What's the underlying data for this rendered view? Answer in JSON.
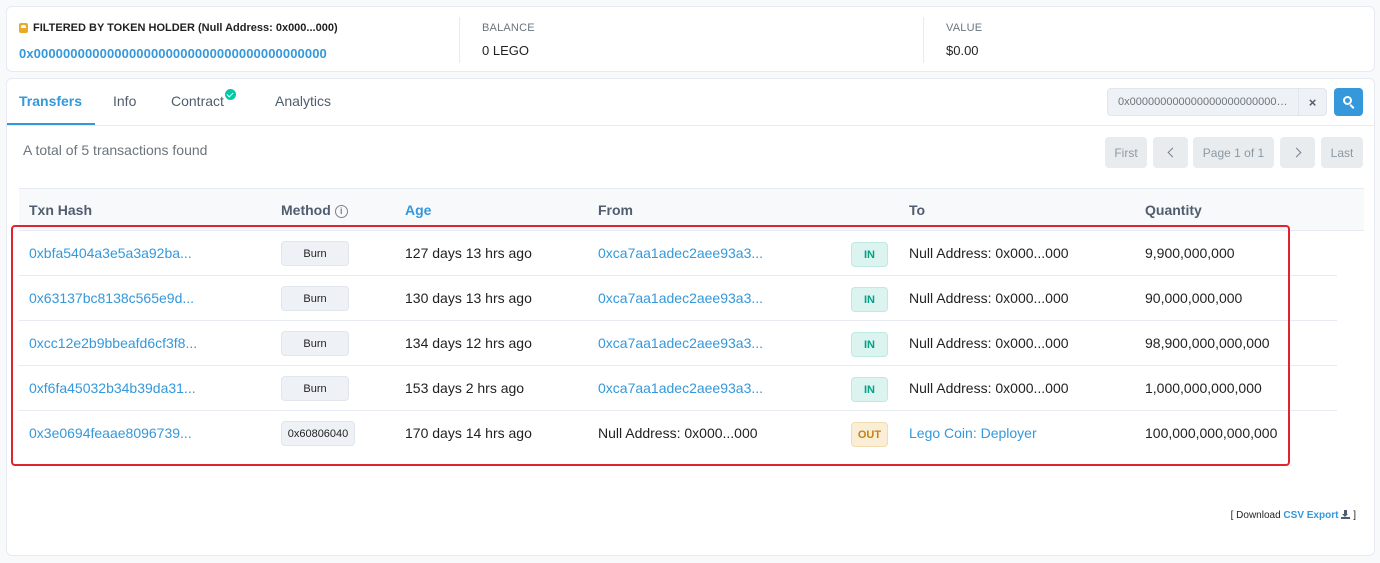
{
  "summary": {
    "filter_label": "FILTERED BY TOKEN HOLDER (Null Address: 0x000...000)",
    "holder_address": "0x0000000000000000000000000000000000000000",
    "balance_label": "BALANCE",
    "balance_value": "0 LEGO",
    "value_label": "VALUE",
    "value_value": "$0.00"
  },
  "tabs": [
    {
      "label": "Transfers",
      "active": true
    },
    {
      "label": "Info",
      "active": false
    },
    {
      "label": "Contract",
      "active": false,
      "verified": true
    },
    {
      "label": "Analytics",
      "active": false
    }
  ],
  "search": {
    "value": "0x0000000000000000000000000000000000000000",
    "clear_label": "×"
  },
  "total_text": "A total of 5 transactions found",
  "pagination": {
    "first": "First",
    "page": "Page 1 of 1",
    "last": "Last"
  },
  "table": {
    "headers": {
      "txn_hash": "Txn Hash",
      "method": "Method",
      "age": "Age",
      "from": "From",
      "to": "To",
      "quantity": "Quantity"
    },
    "rows": [
      {
        "hash": "0xbfa5404a3e5a3a92ba...",
        "method": "Burn",
        "age": "127 days 13 hrs ago",
        "from": "0xca7aa1adec2aee93a3...",
        "direction": "IN",
        "to": "Null Address: 0x000...000",
        "quantity": "9,900,000,000"
      },
      {
        "hash": "0x63137bc8138c565e9d...",
        "method": "Burn",
        "age": "130 days 13 hrs ago",
        "from": "0xca7aa1adec2aee93a3...",
        "direction": "IN",
        "to": "Null Address: 0x000...000",
        "quantity": "90,000,000,000"
      },
      {
        "hash": "0xcc12e2b9bbeafd6cf3f8...",
        "method": "Burn",
        "age": "134 days 12 hrs ago",
        "from": "0xca7aa1adec2aee93a3...",
        "direction": "IN",
        "to": "Null Address: 0x000...000",
        "quantity": "98,900,000,000,000"
      },
      {
        "hash": "0xf6fa45032b34b39da31...",
        "method": "Burn",
        "age": "153 days 2 hrs ago",
        "from": "0xca7aa1adec2aee93a3...",
        "direction": "IN",
        "to": "Null Address: 0x000...000",
        "quantity": "1,000,000,000,000"
      },
      {
        "hash": "0x3e0694feaae8096739...",
        "method": "0x60806040",
        "age": "170 days 14 hrs ago",
        "from": "Null Address: 0x000...000",
        "direction": "OUT",
        "to": "Lego Coin: Deployer",
        "quantity": "100,000,000,000,000"
      }
    ]
  },
  "footer": {
    "prefix": "[ Download",
    "link": "CSV Export",
    "suffix": "]"
  },
  "colors": {
    "accent": "#3498db",
    "in": "#00a186",
    "out": "#c48315",
    "highlight": "#e0242f"
  }
}
